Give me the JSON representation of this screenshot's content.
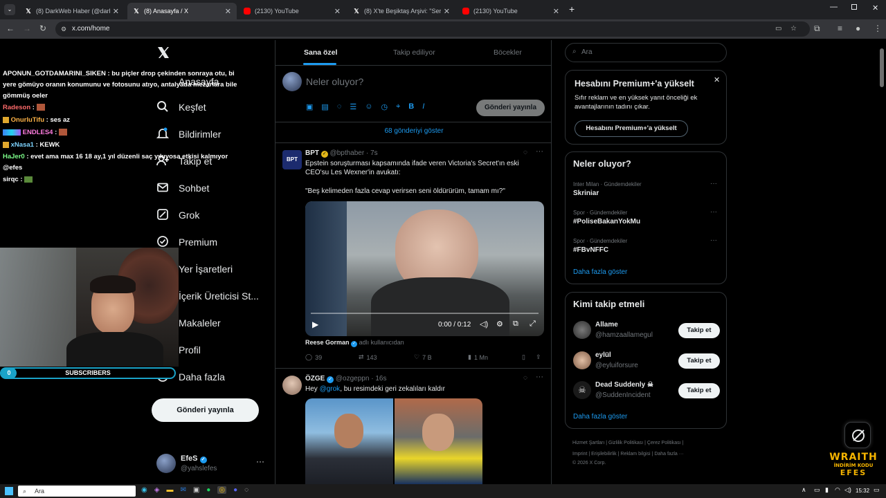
{
  "browser": {
    "tabs": [
      {
        "title": "(8) DarkWeb Haber (@darkweb",
        "icon": "x-logo-icon"
      },
      {
        "title": "(8) Anasayfa / X",
        "icon": "x-logo-icon",
        "active": true
      },
      {
        "title": "(2130) YouTube",
        "icon": "youtube-icon"
      },
      {
        "title": "(8) X'te Beşiktaş Arşivi: \"Sergen Y",
        "icon": "x-logo-icon"
      },
      {
        "title": "(2130) YouTube",
        "icon": "youtube-icon"
      }
    ],
    "url": "x.com/home"
  },
  "chat": [
    {
      "user": "APONUN_GOTDAMARINI_SIKEN",
      "msg": ": bu piçler drop çekinden sonraya otu, bi yere gömüyo oranın konumunu ve fotosunu atıyo, antalyada mezarlara bile gömmüş oeler",
      "color": "#ffffff"
    },
    {
      "user": "Radeson",
      "msg": ":",
      "color": "#ff6b6b"
    },
    {
      "user": "OnurluTifu",
      "msg": ": ses az",
      "color": "#ffb347"
    },
    {
      "user": "ENDLES4",
      "msg": ":",
      "color": "#ff7de0"
    },
    {
      "user": "xNasa1",
      "msg": ": KEWK",
      "color": "#7dd3ff"
    },
    {
      "user": "HaJer0",
      "msg": ": evet ama max 16 18 ay,1 yıl düzenli saç yıkıyosa etkisi kalmıyor @efes",
      "color": "#7dff8a"
    },
    {
      "user": "sirqc",
      "msg": ":",
      "color": "#ffffff"
    }
  ],
  "overlay": {
    "subs_count": "0",
    "subs_label": "SUBSCRIBERS",
    "sponsor_line1": "WRAITH",
    "sponsor_line2": "İNDİRİM KODU",
    "sponsor_line3": "EFES"
  },
  "nav": {
    "items": [
      {
        "label": "Keşfet",
        "icon": "search-icon"
      },
      {
        "label": "Bildirimler",
        "icon": "bell-icon"
      },
      {
        "label": "Takip et",
        "icon": "person-plus-icon"
      },
      {
        "label": "Sohbet",
        "icon": "mail-icon"
      },
      {
        "label": "Grok",
        "icon": "grok-icon"
      },
      {
        "label": "Premium",
        "icon": "x-premium-icon"
      },
      {
        "label": "Yer İşaretleri",
        "icon": "bookmark-icon"
      },
      {
        "label": "İçerik Üreticisi St...",
        "icon": "studio-icon"
      },
      {
        "label": "Makaleler",
        "icon": "article-icon"
      },
      {
        "label": "Profil",
        "icon": "person-icon"
      },
      {
        "label": "Daha fazla",
        "icon": "more-circle-icon"
      }
    ],
    "post_button": "Gönderi yayınla",
    "account": {
      "name": "EfeS",
      "handle": "@yahslefes"
    }
  },
  "main": {
    "tabs": [
      "Sana özel",
      "Takip ediliyor",
      "Böcekler"
    ],
    "composer_placeholder": "Neler oluyor?",
    "composer_post": "Gönderi yayınla",
    "show_more": "68 gönderiyi göster",
    "tweets": [
      {
        "name": "BPT",
        "handle": "@bpthaber",
        "time": "· 7s",
        "text1": "Epstein soruşturması kapsamında ifade veren Victoria's Secret'ın eski CEO'su Les Wexner'in avukatı:",
        "text2": "\"Beş kelimeden fazla cevap verirsen seni öldürürüm, tamam mı?\"",
        "video_time": "0:00 / 0:12",
        "credit_name": "Reese Gorman",
        "credit_suffix": "adlı kullanıcıdan",
        "replies": "39",
        "reposts": "143",
        "likes": "7 B",
        "views": "1 Mn"
      },
      {
        "name": "ÖZGE",
        "handle": "@ozgeppn",
        "time": "· 16s",
        "text_mention": "@grok",
        "text_prefix": "Hey",
        "text_suffix": ", bu resimdeki geri zekalıları kaldır"
      }
    ]
  },
  "right": {
    "search_placeholder": "Ara",
    "premium": {
      "title": "Hesabını Premium+'a yükselt",
      "body": "Sıfır reklam ve en yüksek yanıt önceliği ek avantajlarının tadını çıkar.",
      "button": "Hesabını Premium+'a yükselt"
    },
    "trends_title": "Neler oluyor?",
    "trends": [
      {
        "meta": "Inter Milan · Gündemdekiler",
        "name": "Skriniar"
      },
      {
        "meta": "Spor · Gündemdekiler",
        "name": "#PoliseBakanYokMu"
      },
      {
        "meta": "Spor · Gündemdekiler",
        "name": "#FBvNFFC"
      }
    ],
    "trends_more": "Daha fazla göster",
    "who_title": "Kimi takip etmeli",
    "who": [
      {
        "name": "Allame",
        "handle": "@hamzaallamegul",
        "button": "Takip et"
      },
      {
        "name": "eylül",
        "handle": "@eyluiforsure",
        "button": "Takip et"
      },
      {
        "name": "Dead Suddenly ☠",
        "handle": "@SuddenIncident",
        "button": "Takip et"
      }
    ],
    "who_more": "Daha fazla göster",
    "footer": [
      "Hizmet Şartları",
      "Gizlilik Politikası",
      "Çerez Politikası",
      "Imprint",
      "Erişilebilirlik",
      "Reklam bilgisi",
      "Daha fazla ···",
      "© 2026 X Corp."
    ]
  },
  "taskbar": {
    "search": "Ara",
    "time": "15:32"
  }
}
